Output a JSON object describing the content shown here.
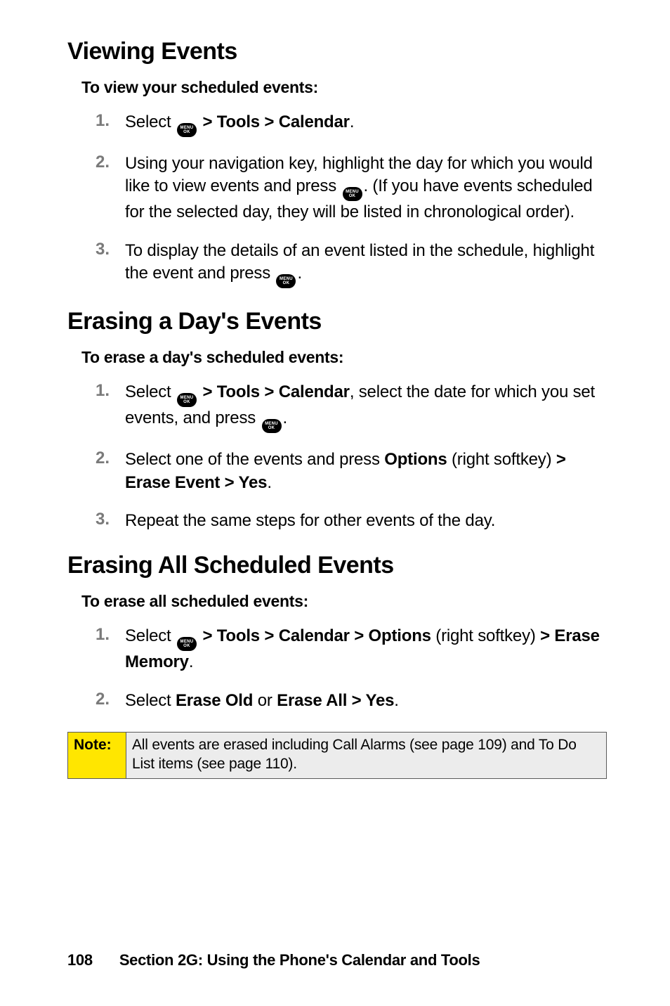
{
  "sections": [
    {
      "heading": "Viewing Events",
      "intro": "To view your scheduled events:",
      "steps": [
        {
          "num": "1.",
          "pre": "Select ",
          "post": " ",
          "bold1": "> Tools > Calendar",
          "tail": "."
        },
        {
          "num": "2.",
          "pre": "Using your navigation key, highlight the day for which you would like to view events and press ",
          "post": ". (If you have events scheduled for the selected day, they will be listed in chronological order)."
        },
        {
          "num": "3.",
          "pre": "To display the details of an event listed in the schedule, highlight the event and press ",
          "post": "."
        }
      ]
    },
    {
      "heading": "Erasing a Day's Events",
      "intro": "To erase a day's scheduled events:",
      "steps": [
        {
          "num": "1.",
          "pre": "Select ",
          "bold1": " > Tools > Calendar",
          "mid": ", select the date for which you set events, and press ",
          "post": "."
        },
        {
          "num": "2.",
          "text": "Select one of the events and press ",
          "bold1": "Options",
          "mid": " (right softkey) ",
          "bold2": "> Erase Event > Yes",
          "tail": "."
        },
        {
          "num": "3.",
          "text": "Repeat the same steps for other events of the day."
        }
      ]
    },
    {
      "heading": "Erasing All Scheduled Events",
      "intro": "To erase all scheduled events:",
      "steps": [
        {
          "num": "1.",
          "pre": "Select ",
          "bold1": " > Tools > Calendar > Options",
          "mid": " (right softkey) ",
          "bold2": "> Erase Memory",
          "tail": "."
        },
        {
          "num": "2.",
          "text": " Select ",
          "bold1": "Erase Old",
          "mid": " or ",
          "bold2": "Erase All > Yes",
          "tail": "."
        }
      ]
    }
  ],
  "note": {
    "label": "Note:",
    "body": "All events are erased including Call Alarms (see page 109) and To Do List items (see page 110)."
  },
  "footer": {
    "page": "108",
    "title": "Section 2G: Using the Phone's Calendar and Tools"
  },
  "icon_label": "MENU\nOK"
}
